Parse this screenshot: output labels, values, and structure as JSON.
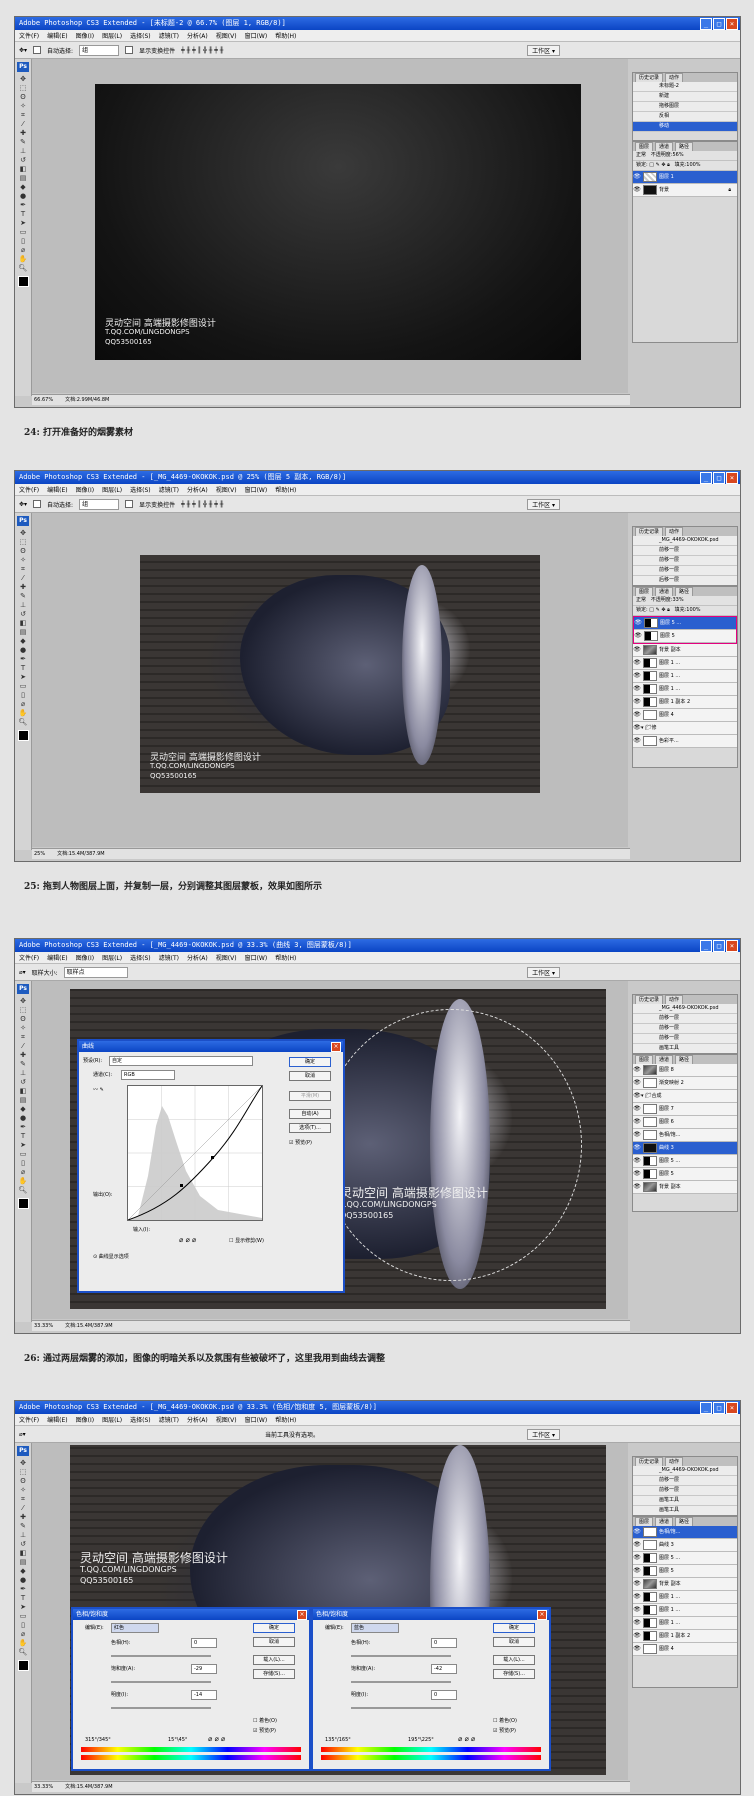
{
  "menus": [
    "文件(F)",
    "编辑(E)",
    "图像(I)",
    "图层(L)",
    "选择(S)",
    "滤镜(T)",
    "分析(A)",
    "视图(V)",
    "窗口(W)",
    "帮助(H)"
  ],
  "workspace_label": "工作区 ▾",
  "colors": {
    "titlebar": "#0b45c4",
    "accent": "#2a5fcf",
    "highlight": "#e4007f"
  },
  "steps": [
    {
      "title": "Adobe Photoshop CS3 Extended - [未标题-2 @ 66.7% (图层 1, RGB/8)]",
      "options": {
        "auto_select": "自动选择:",
        "select_value": "组",
        "show_transform": "显示变换控件"
      },
      "status": {
        "zoom": "66.67%",
        "doc": "文档:2.99M/46.8M"
      },
      "history_tabs": [
        "历史记录",
        "动作"
      ],
      "history": [
        "未标题-2",
        "新建",
        "拖移图层",
        "反相",
        "移动"
      ],
      "layers_tabs": [
        "图层",
        "通道",
        "路径"
      ],
      "blend": "正常",
      "opacity_label": "不透明度:",
      "opacity": "56%",
      "lock_label": "锁定:",
      "fill_label": "填充:",
      "fill": "100%",
      "layers": [
        {
          "name": "图层 1",
          "thumb": "check"
        },
        {
          "name": "背景",
          "thumb": "dark"
        }
      ],
      "watermark": {
        "line1": "灵动空间 高端摄影修图设计",
        "line2": "T.QQ.COM/LINGDONGPS",
        "line3": "QQ53500165"
      },
      "caption": "24: 打开准备好的烟雾素材"
    },
    {
      "title": "Adobe Photoshop CS3 Extended - [_MG_4469-OKOKOK.psd @ 25% (图层 5 副本, RGB/8)]",
      "options": {
        "auto_select": "自动选择:",
        "select_value": "组",
        "show_transform": "显示变换控件"
      },
      "status": {
        "zoom": "25%",
        "doc": "文档:15.4M/387.9M"
      },
      "history": [
        "_MG_4469-OKOKOK.psd",
        "前移一层",
        "前移一层",
        "前移一层",
        "后移一层"
      ],
      "blend": "正常",
      "opacity": "33%",
      "fill": "100%",
      "layers": [
        {
          "name": "图层 5 ...",
          "thumb": "mixed"
        },
        {
          "name": "图层 5",
          "thumb": "mixed"
        },
        {
          "name": "背景 副本",
          "thumb": "photo"
        },
        {
          "name": "图层 1 ...",
          "thumb": "mixed"
        },
        {
          "name": "图层 1 ...",
          "thumb": "mixed"
        },
        {
          "name": "图层 1 ...",
          "thumb": "mixed"
        },
        {
          "name": "图层 1 副本 2",
          "thumb": "mixed"
        },
        {
          "name": "图层 4",
          "thumb": "white"
        },
        {
          "name": "修",
          "thumb": "white"
        },
        {
          "name": "色彩平...",
          "thumb": "white"
        }
      ],
      "caption": "25: 拖到人物图层上面，并复制一层，分别调整其图层蒙板，效果如图所示"
    },
    {
      "title": "Adobe Photoshop CS3 Extended - [_MG_4469-OKOKOK.psd @ 33.3% (曲线 3, 图层蒙板/8)]",
      "options": {
        "sample_label": "取样大小:",
        "sample_value": "取样点"
      },
      "status": {
        "zoom": "33.33%",
        "doc": "文档:15.4M/387.9M"
      },
      "history": [
        "_MG_4469-OKOKOK.psd",
        "前移一层",
        "前移一层",
        "前移一层",
        "画笔工具"
      ],
      "layers": [
        {
          "name": "图层 8",
          "thumb": "photo"
        },
        {
          "name": "渐变映射 2",
          "thumb": "white"
        },
        {
          "name": "合成",
          "thumb": "white"
        },
        {
          "name": "图层 7",
          "thumb": "white"
        },
        {
          "name": "图层 6",
          "thumb": "white"
        },
        {
          "name": "色相/饱...",
          "thumb": "white"
        },
        {
          "name": "曲线 3",
          "thumb": "dark"
        },
        {
          "name": "图层 5 ...",
          "thumb": "mixed"
        },
        {
          "name": "图层 5",
          "thumb": "mixed"
        },
        {
          "name": "背景 副本",
          "thumb": "photo"
        }
      ],
      "curves": {
        "title": "曲线",
        "preset_label": "预设(R):",
        "preset_value": "自定",
        "channel_label": "通道(C):",
        "channel_value": "RGB",
        "output_label": "输出(O):",
        "input_label": "输入(I):",
        "show_clipping": "显示修剪(W)",
        "display_options": "曲线显示选项",
        "buttons": [
          "确定",
          "取消",
          "平滑(M)",
          "自动(A)",
          "选项(T)..."
        ],
        "preview": "预览(P)"
      },
      "caption": "26: 通过两层烟雾的添加，图像的明暗关系以及氛围有些被破坏了，这里我用到曲线去调整"
    },
    {
      "title": "Adobe Photoshop CS3 Extended - [_MG_4469-OKOKOK.psd @ 33.3% (色相/饱和度 5, 图层蒙板/8)]",
      "options": {
        "hint": "当前工具没有选项。"
      },
      "status": {
        "zoom": "33.33%",
        "doc": "文档:15.4M/387.9M"
      },
      "history": [
        "_MG_4469-OKOKOK.psd",
        "前移一层",
        "前移一层",
        "画笔工具",
        "画笔工具"
      ],
      "layers": [
        {
          "name": "色相/饱...",
          "thumb": "white"
        },
        {
          "name": "曲线 3",
          "thumb": "white"
        },
        {
          "name": "图层 5 ...",
          "thumb": "mixed"
        },
        {
          "name": "图层 5",
          "thumb": "mixed"
        },
        {
          "name": "背景 副本",
          "thumb": "photo"
        },
        {
          "name": "图层 1 ...",
          "thumb": "mixed"
        },
        {
          "name": "图层 1 ...",
          "thumb": "mixed"
        },
        {
          "name": "图层 1 ...",
          "thumb": "mixed"
        },
        {
          "name": "图层 1 副本 2",
          "thumb": "mixed"
        },
        {
          "name": "图层 4",
          "thumb": "white"
        }
      ],
      "hue_dialogs": [
        {
          "title": "色相/饱和度",
          "edit_label": "编辑(E):",
          "edit_value": "红色",
          "hue_label": "色相(H):",
          "hue": "0",
          "sat_label": "饱和度(A):",
          "sat": "-29",
          "light_label": "明度(I):",
          "light": "-14",
          "range_left": "315°/345°",
          "range_right": "15°\\45°",
          "buttons": [
            "确定",
            "取消",
            "载入(L)...",
            "存储(S)..."
          ],
          "colorize": "着色(O)",
          "preview": "预览(P)"
        },
        {
          "title": "色相/饱和度",
          "edit_label": "编辑(E):",
          "edit_value": "蓝色",
          "hue_label": "色相(H):",
          "hue": "0",
          "sat_label": "饱和度(A):",
          "sat": "-42",
          "light_label": "明度(I):",
          "light": "0",
          "range_left": "135°/165°",
          "range_right": "195°\\225°",
          "buttons": [
            "确定",
            "取消",
            "载入(L)...",
            "存储(S)..."
          ],
          "colorize": "着色(O)",
          "preview": "预览(P)"
        }
      ]
    }
  ]
}
